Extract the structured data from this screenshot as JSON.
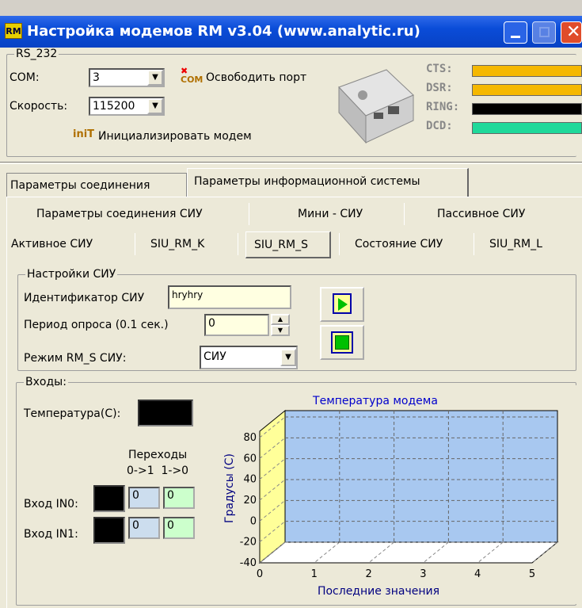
{
  "window": {
    "title": "Настройка модемов RM v3.04 (www.analytic.ru)"
  },
  "rs232": {
    "group_label": "RS_232",
    "com_label": "COM:",
    "com_value": "3",
    "speed_label": "Скорость:",
    "speed_value": "115200",
    "free_port_label": "Освободить порт",
    "init_label": "Инициализировать модем"
  },
  "signals": [
    {
      "label": "CTS:",
      "color": "#f5b800"
    },
    {
      "label": "DSR:",
      "color": "#f5b800"
    },
    {
      "label": "RING:",
      "color": "#000000"
    },
    {
      "label": "DCD:",
      "color": "#1fd99a"
    }
  ],
  "tabs_main": [
    "Параметры соединения",
    "Параметры информационной системы"
  ],
  "tabs_row2": [
    "Параметры соединения СИУ",
    "Мини - СИУ",
    "Пассивное СИУ"
  ],
  "tabs_row3": [
    "Активное СИУ",
    "SIU_RM_K",
    "SIU_RM_S",
    "Состояние СИУ",
    "SIU_RM_L"
  ],
  "settings": {
    "group_label": "Настройки СИУ",
    "id_label": "Идентификатор СИУ",
    "id_value": "hryhry",
    "period_label": "Период опроса (0.1 сек.)",
    "period_value": "0",
    "mode_label": "Режим RM_S СИУ:",
    "mode_value": "СИУ"
  },
  "inputs": {
    "group_label": "Входы:",
    "temp_label": "Температура(С):",
    "transitions_label": "Переходы",
    "transitions_cols": "0->1  1->0",
    "in0_label": "Вход IN0:",
    "in0_01": "0",
    "in0_10": "0",
    "in1_label": "Вход IN1:",
    "in1_01": "0",
    "in1_10": "0"
  },
  "chart_data": {
    "type": "area",
    "title": "Температура модема",
    "xlabel": "Последние значения",
    "ylabel": "Градусы (С)",
    "xlim": [
      0,
      5
    ],
    "ylim": [
      -40,
      80
    ],
    "x_ticks": [
      0,
      1,
      2,
      3,
      4,
      5
    ],
    "y_ticks": [
      80,
      60,
      40,
      20,
      0,
      -20,
      -40
    ],
    "series": [],
    "grid": true,
    "colors": {
      "back_wall": "#a8c8f0",
      "side_wall": "#ffff99",
      "title": "#0000cc"
    }
  }
}
